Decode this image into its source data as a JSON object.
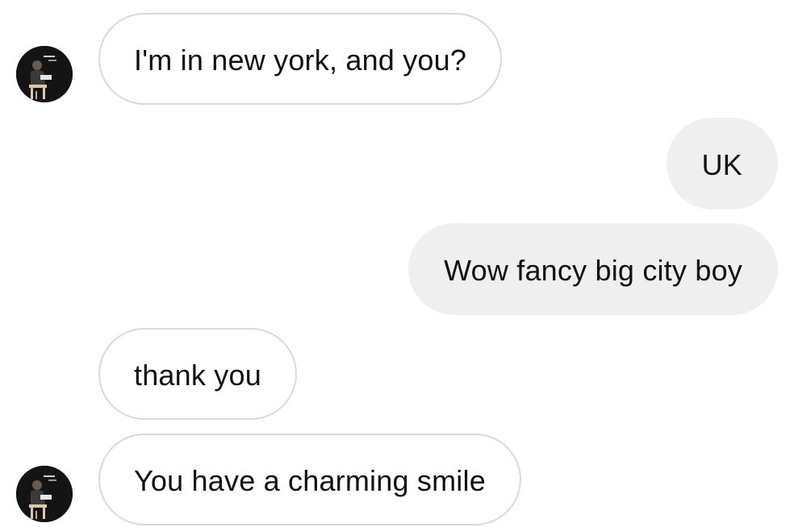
{
  "messages": [
    {
      "direction": "incoming",
      "text": "I'm in new york, and you?",
      "has_avatar": true
    },
    {
      "direction": "outgoing",
      "text": "UK",
      "has_avatar": false
    },
    {
      "direction": "outgoing",
      "text": "Wow fancy big city boy",
      "has_avatar": false
    },
    {
      "direction": "incoming",
      "text": "thank you",
      "has_avatar": false
    },
    {
      "direction": "incoming",
      "text": "You have a charming smile",
      "has_avatar": true
    }
  ],
  "colors": {
    "incoming_bubble_bg": "#ffffff",
    "incoming_bubble_border": "#dadada",
    "outgoing_bubble_bg": "#efefef",
    "text": "#111111",
    "avatar_bg": "#111111"
  },
  "icons": {
    "avatar": "profile-photo-icon"
  }
}
